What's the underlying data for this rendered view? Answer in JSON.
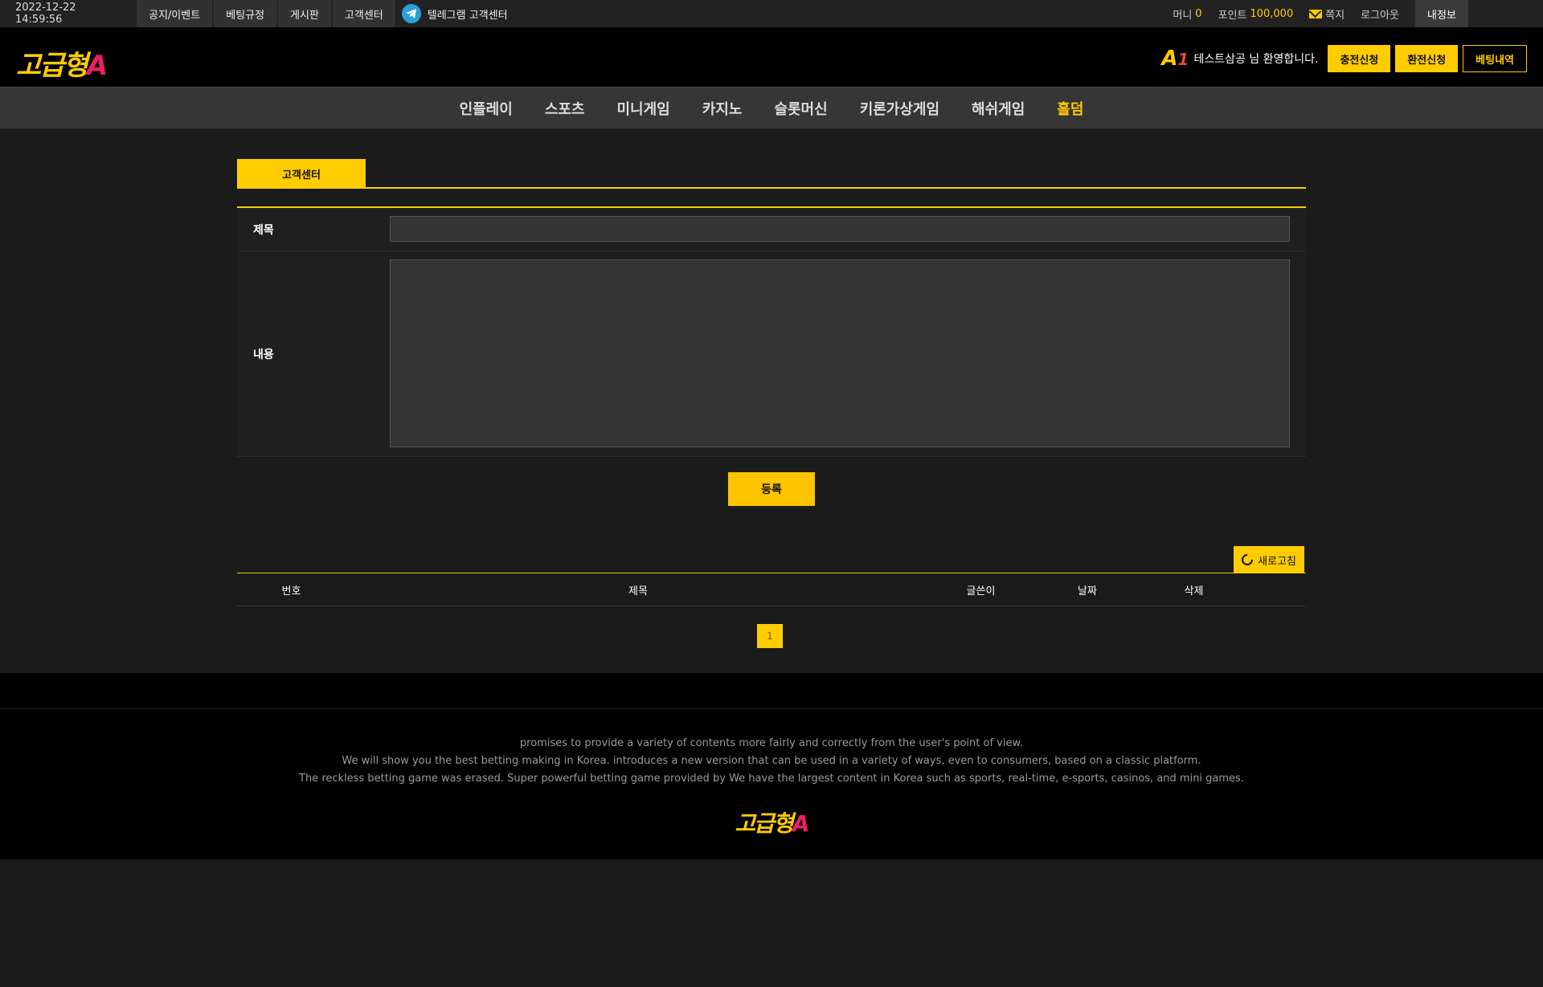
{
  "topbar": {
    "datetime": "2022-12-22 14:59:56",
    "links": [
      "공지/이벤트",
      "베팅규정",
      "게시판",
      "고객센터"
    ],
    "telegram": "텔레그램 고객센터",
    "money_label": "머니",
    "money_value": "0",
    "point_label": "포인트",
    "point_value": "100,000",
    "message": "쪽지",
    "logout": "로그아웃",
    "myinfo": "내정보"
  },
  "header": {
    "logo_text": "고급형",
    "logo_accent": "A",
    "badge_a": "A",
    "badge_1": "1",
    "welcome": "테스트삼공 님 환영합니다.",
    "btn_deposit": "충전신청",
    "btn_withdraw": "환전신청",
    "btn_history": "베팅내역"
  },
  "nav": [
    "인플레이",
    "스포츠",
    "미니게임",
    "카지노",
    "슬롯머신",
    "키론가상게임",
    "해쉬게임",
    "홀덤"
  ],
  "content": {
    "tab": "고객센터",
    "title_label": "제목",
    "body_label": "내용",
    "submit": "등록",
    "refresh": "새로고침",
    "columns": [
      "번호",
      "제목",
      "글쓴이",
      "날짜",
      "삭제"
    ],
    "page": "1"
  },
  "footer": {
    "lines": [
      "promises to provide a variety of contents more fairly and correctly from the user's point of view.",
      "We will show you the best betting making in Korea. introduces a new version that can be used in a variety of ways, even to consumers, based on a classic platform.",
      "The reckless betting game was erased. Super powerful betting game provided by  We have the largest content in Korea such as sports, real-time, e-sports, casinos, and mini games."
    ],
    "logo_text": "고급형",
    "logo_accent": "A"
  },
  "colors": {
    "accent": "#ffcc00",
    "background": "#1b1b1b"
  }
}
